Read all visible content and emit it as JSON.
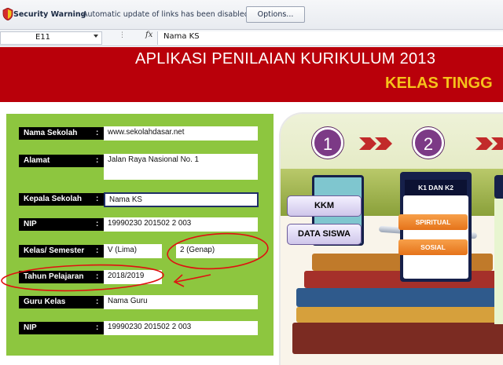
{
  "security_bar": {
    "title": "Security Warning",
    "message": "Automatic update of links has been disabled",
    "options_label": "Options..."
  },
  "formula_bar": {
    "cell_ref": "E11",
    "fx_label": "fx",
    "formula": "Nama KS"
  },
  "header": {
    "title": "APLIKASI PENILAIAN KURIKULUM 2013",
    "subtitle": "KELAS TINGG"
  },
  "form": {
    "fields": [
      {
        "label": "Nama Sekolah",
        "value": "www.sekolahdasar.net"
      },
      {
        "label": "Alamat",
        "value": "Jalan Raya Nasional No. 1"
      },
      {
        "label": "Kepala Sekolah",
        "value": "Nama KS"
      },
      {
        "label": "NIP",
        "value": "19990230 201502 2 003"
      },
      {
        "label": "Kelas/ Semester",
        "value": "V (Lima)",
        "value2": "2 (Genap)"
      },
      {
        "label": "Tahun Pelajaran",
        "value": "2018/2019"
      },
      {
        "label": "Guru Kelas",
        "value": "Nama Guru"
      },
      {
        "label": "NIP",
        "value": "19990230 201502 2 003"
      }
    ],
    "colon": ":"
  },
  "graphic": {
    "step1": "1",
    "step2": "2",
    "kkm_label": "KKM",
    "data_siswa_label": "DATA SISWA",
    "k1k2_label": "K1 DAN K2",
    "spiritual_label": "SPIRITUAL",
    "sosial_label": "SOSIAL"
  },
  "colors": {
    "header_red": "#b9000a",
    "title_yellow": "#f6c21b",
    "panel_green": "#8dc63f",
    "step_purple": "#7c3a86",
    "annotation_red": "#e01010"
  }
}
